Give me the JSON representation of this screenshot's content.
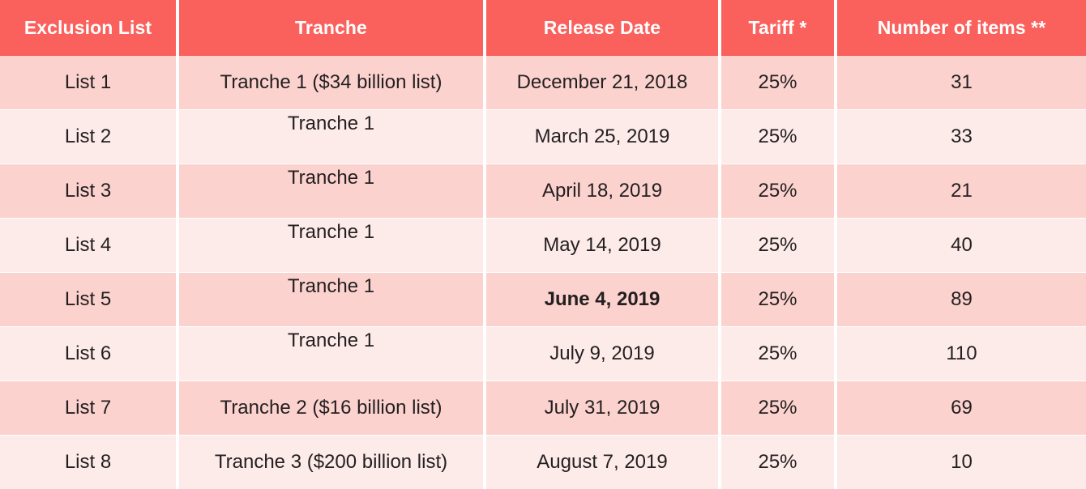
{
  "table": {
    "columns": [
      {
        "key": "exclusion_list",
        "label": "Exclusion List"
      },
      {
        "key": "tranche",
        "label": "Tranche"
      },
      {
        "key": "release_date",
        "label": "Release Date"
      },
      {
        "key": "tariff",
        "label": "Tariff  *"
      },
      {
        "key": "number_of_items",
        "label": "Number of items **"
      }
    ],
    "rows": [
      {
        "exclusion_list": "List 1",
        "tranche": "Tranche 1 ($34 billion list)",
        "release_date": "December 21, 2018",
        "tariff": "25%",
        "number_of_items": "31"
      },
      {
        "exclusion_list": "List 2",
        "tranche": "Tranche 1",
        "release_date": "March 25, 2019",
        "tariff": "25%",
        "number_of_items": "33"
      },
      {
        "exclusion_list": "List 3",
        "tranche": "Tranche 1",
        "release_date": "April 18, 2019",
        "tariff": "25%",
        "number_of_items": "21"
      },
      {
        "exclusion_list": "List 4",
        "tranche": "Tranche 1",
        "release_date": "May 14, 2019",
        "tariff": "25%",
        "number_of_items": "40"
      },
      {
        "exclusion_list": "List 5",
        "tranche": "Tranche 1",
        "release_date": "June 4, 2019",
        "tariff": "25%",
        "number_of_items": "89"
      },
      {
        "exclusion_list": "List 6",
        "tranche": "Tranche 1",
        "release_date": "July 9, 2019",
        "tariff": "25%",
        "number_of_items": "110"
      },
      {
        "exclusion_list": "List 7",
        "tranche": "Tranche 2 ($16 billion list)",
        "release_date": "July 31, 2019",
        "tariff": "25%",
        "number_of_items": "69"
      },
      {
        "exclusion_list": "List 8",
        "tranche": "Tranche 3 ($200 billion list)",
        "release_date": "August 7, 2019",
        "tariff": "25%",
        "number_of_items": "10"
      }
    ],
    "styles": {
      "header_background": "#fa605c",
      "header_text": "#ffffff",
      "row_dark": "#fbd2ce",
      "row_light": "#fdebe9",
      "body_text": "#231f20",
      "gridline": "#ffffff"
    },
    "raised_tranche_rows": [
      1,
      2,
      3,
      4,
      5
    ],
    "bold_date_rows": [
      4
    ]
  }
}
